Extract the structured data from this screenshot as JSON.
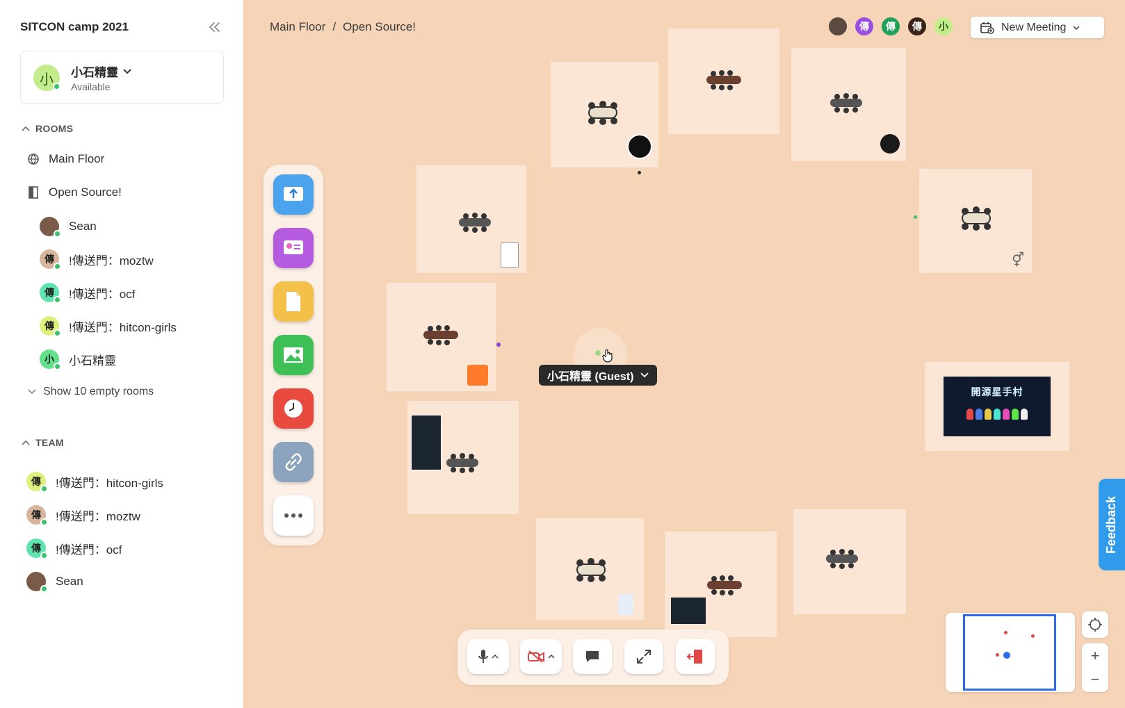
{
  "workspace": {
    "title": "SITCON camp 2021"
  },
  "current_user": {
    "name": "小石精靈",
    "status": "Available",
    "initial": "小"
  },
  "rooms": {
    "heading": "ROOMS",
    "main_floor": "Main Floor",
    "open_source": "Open Source!",
    "members": [
      {
        "name": "Sean",
        "initial": ""
      },
      {
        "name": "!傳送門：moztw",
        "initial": "傳"
      },
      {
        "name": "!傳送門：ocf",
        "initial": "傳"
      },
      {
        "name": "!傳送門：hitcon-girls",
        "initial": "傳"
      },
      {
        "name": "小石精靈",
        "initial": "小"
      }
    ],
    "show_empty": "Show 10 empty rooms"
  },
  "team": {
    "heading": "TEAM",
    "members": [
      {
        "name": "!傳送門：hitcon-girls",
        "initial": "傳"
      },
      {
        "name": "!傳送門：moztw",
        "initial": "傳"
      },
      {
        "name": "!傳送門：ocf",
        "initial": "傳"
      },
      {
        "name": "Sean",
        "initial": ""
      }
    ]
  },
  "breadcrumb": {
    "root": "Main Floor",
    "sep": "/",
    "current": "Open Source!"
  },
  "header_avatars": [
    "",
    "傳",
    "傳",
    "傳",
    "小"
  ],
  "new_meeting": {
    "label": "New Meeting"
  },
  "me_label": "小石精靈 (Guest)",
  "screen_share": {
    "title": "開源星手村"
  },
  "feedback": {
    "label": "Feedback"
  },
  "zoom": {
    "plus": "+",
    "minus": "−"
  },
  "colors": {
    "map_bg": "#f6d4b8",
    "room_bg": "#fbe6d5",
    "accent": "#2d6be6",
    "feedback": "#2f9bea",
    "online": "#3ac26b"
  }
}
